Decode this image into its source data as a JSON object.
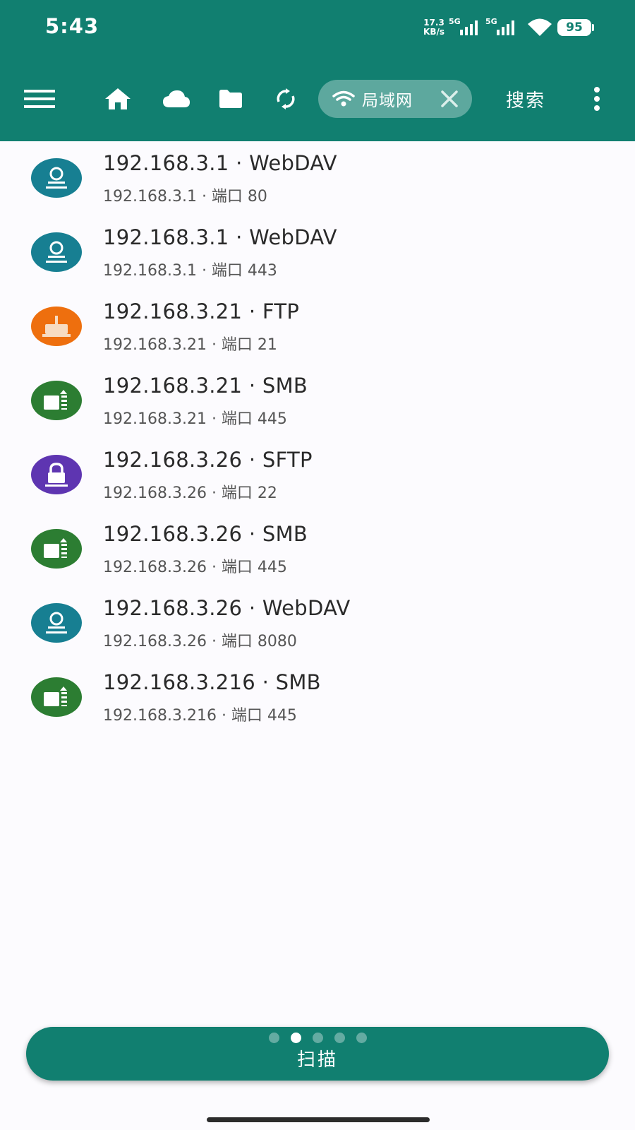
{
  "status_bar": {
    "time": "5:43",
    "net_speed_value": "17.3",
    "net_speed_unit": "KB/s",
    "sim1_label": "5G",
    "sim2_label": "5G",
    "battery_level": "95"
  },
  "toolbar": {
    "menu_icon": "hamburger-menu-icon",
    "home_icon": "home-icon",
    "cloud_icon": "cloud-icon",
    "folder_icon": "folder-icon",
    "sync_icon": "sync-icon",
    "filter_chip": {
      "icon": "wifi-icon",
      "label": "局域网",
      "close_icon": "close-icon"
    },
    "search_label": "搜索",
    "more_icon": "more-vert-icon"
  },
  "servers": [
    {
      "title": "192.168.3.1 · WebDAV",
      "subtitle": "192.168.3.1 · 端口 80",
      "protocol": "WebDAV",
      "color": "#177f92"
    },
    {
      "title": "192.168.3.1 · WebDAV",
      "subtitle": "192.168.3.1 · 端口 443",
      "protocol": "WebDAV",
      "color": "#177f92"
    },
    {
      "title": "192.168.3.21 · FTP",
      "subtitle": "192.168.3.21 · 端口 21",
      "protocol": "FTP",
      "color": "#ee6f0e"
    },
    {
      "title": "192.168.3.21 · SMB",
      "subtitle": "192.168.3.21 · 端口 445",
      "protocol": "SMB",
      "color": "#2c7d32"
    },
    {
      "title": "192.168.3.26 · SFTP",
      "subtitle": "192.168.3.26 · 端口 22",
      "protocol": "SFTP",
      "color": "#5e35b1"
    },
    {
      "title": "192.168.3.26 · SMB",
      "subtitle": "192.168.3.26 · 端口 445",
      "protocol": "SMB",
      "color": "#2c7d32"
    },
    {
      "title": "192.168.3.26 · WebDAV",
      "subtitle": "192.168.3.26 · 端口 8080",
      "protocol": "WebDAV",
      "color": "#177f92"
    },
    {
      "title": "192.168.3.216 · SMB",
      "subtitle": "192.168.3.216 · 端口 445",
      "protocol": "SMB",
      "color": "#2c7d32"
    }
  ],
  "scan_button": {
    "label": "扫描",
    "page_indicator": {
      "count": 5,
      "active_index": 1
    }
  },
  "colors": {
    "primary": "#117f70",
    "background": "#fcfbfe"
  }
}
